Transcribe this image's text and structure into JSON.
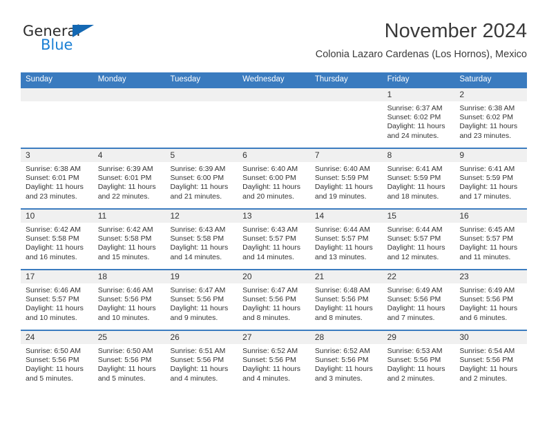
{
  "brand": {
    "name_part1": "General",
    "name_part2": "Blue",
    "primary_color": "#1a7fd4",
    "header_color": "#3a7bbf"
  },
  "header": {
    "month_title": "November 2024",
    "location": "Colonia Lazaro Cardenas (Los Hornos), Mexico"
  },
  "weekdays": [
    "Sunday",
    "Monday",
    "Tuesday",
    "Wednesday",
    "Thursday",
    "Friday",
    "Saturday"
  ],
  "labels": {
    "sunrise_prefix": "Sunrise:",
    "sunset_prefix": "Sunset:",
    "daylight_prefix": "Daylight:"
  },
  "weeks": [
    [
      {
        "day": "",
        "sunrise": "",
        "sunset": "",
        "daylight_line1": "",
        "daylight_line2": "",
        "empty": true
      },
      {
        "day": "",
        "sunrise": "",
        "sunset": "",
        "daylight_line1": "",
        "daylight_line2": "",
        "empty": true
      },
      {
        "day": "",
        "sunrise": "",
        "sunset": "",
        "daylight_line1": "",
        "daylight_line2": "",
        "empty": true
      },
      {
        "day": "",
        "sunrise": "",
        "sunset": "",
        "daylight_line1": "",
        "daylight_line2": "",
        "empty": true
      },
      {
        "day": "",
        "sunrise": "",
        "sunset": "",
        "daylight_line1": "",
        "daylight_line2": "",
        "empty": true
      },
      {
        "day": "1",
        "sunrise": "Sunrise: 6:37 AM",
        "sunset": "Sunset: 6:02 PM",
        "daylight_line1": "Daylight: 11 hours",
        "daylight_line2": "and 24 minutes.",
        "empty": false
      },
      {
        "day": "2",
        "sunrise": "Sunrise: 6:38 AM",
        "sunset": "Sunset: 6:02 PM",
        "daylight_line1": "Daylight: 11 hours",
        "daylight_line2": "and 23 minutes.",
        "empty": false
      }
    ],
    [
      {
        "day": "3",
        "sunrise": "Sunrise: 6:38 AM",
        "sunset": "Sunset: 6:01 PM",
        "daylight_line1": "Daylight: 11 hours",
        "daylight_line2": "and 23 minutes.",
        "empty": false
      },
      {
        "day": "4",
        "sunrise": "Sunrise: 6:39 AM",
        "sunset": "Sunset: 6:01 PM",
        "daylight_line1": "Daylight: 11 hours",
        "daylight_line2": "and 22 minutes.",
        "empty": false
      },
      {
        "day": "5",
        "sunrise": "Sunrise: 6:39 AM",
        "sunset": "Sunset: 6:00 PM",
        "daylight_line1": "Daylight: 11 hours",
        "daylight_line2": "and 21 minutes.",
        "empty": false
      },
      {
        "day": "6",
        "sunrise": "Sunrise: 6:40 AM",
        "sunset": "Sunset: 6:00 PM",
        "daylight_line1": "Daylight: 11 hours",
        "daylight_line2": "and 20 minutes.",
        "empty": false
      },
      {
        "day": "7",
        "sunrise": "Sunrise: 6:40 AM",
        "sunset": "Sunset: 5:59 PM",
        "daylight_line1": "Daylight: 11 hours",
        "daylight_line2": "and 19 minutes.",
        "empty": false
      },
      {
        "day": "8",
        "sunrise": "Sunrise: 6:41 AM",
        "sunset": "Sunset: 5:59 PM",
        "daylight_line1": "Daylight: 11 hours",
        "daylight_line2": "and 18 minutes.",
        "empty": false
      },
      {
        "day": "9",
        "sunrise": "Sunrise: 6:41 AM",
        "sunset": "Sunset: 5:59 PM",
        "daylight_line1": "Daylight: 11 hours",
        "daylight_line2": "and 17 minutes.",
        "empty": false
      }
    ],
    [
      {
        "day": "10",
        "sunrise": "Sunrise: 6:42 AM",
        "sunset": "Sunset: 5:58 PM",
        "daylight_line1": "Daylight: 11 hours",
        "daylight_line2": "and 16 minutes.",
        "empty": false
      },
      {
        "day": "11",
        "sunrise": "Sunrise: 6:42 AM",
        "sunset": "Sunset: 5:58 PM",
        "daylight_line1": "Daylight: 11 hours",
        "daylight_line2": "and 15 minutes.",
        "empty": false
      },
      {
        "day": "12",
        "sunrise": "Sunrise: 6:43 AM",
        "sunset": "Sunset: 5:58 PM",
        "daylight_line1": "Daylight: 11 hours",
        "daylight_line2": "and 14 minutes.",
        "empty": false
      },
      {
        "day": "13",
        "sunrise": "Sunrise: 6:43 AM",
        "sunset": "Sunset: 5:57 PM",
        "daylight_line1": "Daylight: 11 hours",
        "daylight_line2": "and 14 minutes.",
        "empty": false
      },
      {
        "day": "14",
        "sunrise": "Sunrise: 6:44 AM",
        "sunset": "Sunset: 5:57 PM",
        "daylight_line1": "Daylight: 11 hours",
        "daylight_line2": "and 13 minutes.",
        "empty": false
      },
      {
        "day": "15",
        "sunrise": "Sunrise: 6:44 AM",
        "sunset": "Sunset: 5:57 PM",
        "daylight_line1": "Daylight: 11 hours",
        "daylight_line2": "and 12 minutes.",
        "empty": false
      },
      {
        "day": "16",
        "sunrise": "Sunrise: 6:45 AM",
        "sunset": "Sunset: 5:57 PM",
        "daylight_line1": "Daylight: 11 hours",
        "daylight_line2": "and 11 minutes.",
        "empty": false
      }
    ],
    [
      {
        "day": "17",
        "sunrise": "Sunrise: 6:46 AM",
        "sunset": "Sunset: 5:57 PM",
        "daylight_line1": "Daylight: 11 hours",
        "daylight_line2": "and 10 minutes.",
        "empty": false
      },
      {
        "day": "18",
        "sunrise": "Sunrise: 6:46 AM",
        "sunset": "Sunset: 5:56 PM",
        "daylight_line1": "Daylight: 11 hours",
        "daylight_line2": "and 10 minutes.",
        "empty": false
      },
      {
        "day": "19",
        "sunrise": "Sunrise: 6:47 AM",
        "sunset": "Sunset: 5:56 PM",
        "daylight_line1": "Daylight: 11 hours",
        "daylight_line2": "and 9 minutes.",
        "empty": false
      },
      {
        "day": "20",
        "sunrise": "Sunrise: 6:47 AM",
        "sunset": "Sunset: 5:56 PM",
        "daylight_line1": "Daylight: 11 hours",
        "daylight_line2": "and 8 minutes.",
        "empty": false
      },
      {
        "day": "21",
        "sunrise": "Sunrise: 6:48 AM",
        "sunset": "Sunset: 5:56 PM",
        "daylight_line1": "Daylight: 11 hours",
        "daylight_line2": "and 8 minutes.",
        "empty": false
      },
      {
        "day": "22",
        "sunrise": "Sunrise: 6:49 AM",
        "sunset": "Sunset: 5:56 PM",
        "daylight_line1": "Daylight: 11 hours",
        "daylight_line2": "and 7 minutes.",
        "empty": false
      },
      {
        "day": "23",
        "sunrise": "Sunrise: 6:49 AM",
        "sunset": "Sunset: 5:56 PM",
        "daylight_line1": "Daylight: 11 hours",
        "daylight_line2": "and 6 minutes.",
        "empty": false
      }
    ],
    [
      {
        "day": "24",
        "sunrise": "Sunrise: 6:50 AM",
        "sunset": "Sunset: 5:56 PM",
        "daylight_line1": "Daylight: 11 hours",
        "daylight_line2": "and 5 minutes.",
        "empty": false
      },
      {
        "day": "25",
        "sunrise": "Sunrise: 6:50 AM",
        "sunset": "Sunset: 5:56 PM",
        "daylight_line1": "Daylight: 11 hours",
        "daylight_line2": "and 5 minutes.",
        "empty": false
      },
      {
        "day": "26",
        "sunrise": "Sunrise: 6:51 AM",
        "sunset": "Sunset: 5:56 PM",
        "daylight_line1": "Daylight: 11 hours",
        "daylight_line2": "and 4 minutes.",
        "empty": false
      },
      {
        "day": "27",
        "sunrise": "Sunrise: 6:52 AM",
        "sunset": "Sunset: 5:56 PM",
        "daylight_line1": "Daylight: 11 hours",
        "daylight_line2": "and 4 minutes.",
        "empty": false
      },
      {
        "day": "28",
        "sunrise": "Sunrise: 6:52 AM",
        "sunset": "Sunset: 5:56 PM",
        "daylight_line1": "Daylight: 11 hours",
        "daylight_line2": "and 3 minutes.",
        "empty": false
      },
      {
        "day": "29",
        "sunrise": "Sunrise: 6:53 AM",
        "sunset": "Sunset: 5:56 PM",
        "daylight_line1": "Daylight: 11 hours",
        "daylight_line2": "and 2 minutes.",
        "empty": false
      },
      {
        "day": "30",
        "sunrise": "Sunrise: 6:54 AM",
        "sunset": "Sunset: 5:56 PM",
        "daylight_line1": "Daylight: 11 hours",
        "daylight_line2": "and 2 minutes.",
        "empty": false
      }
    ]
  ]
}
